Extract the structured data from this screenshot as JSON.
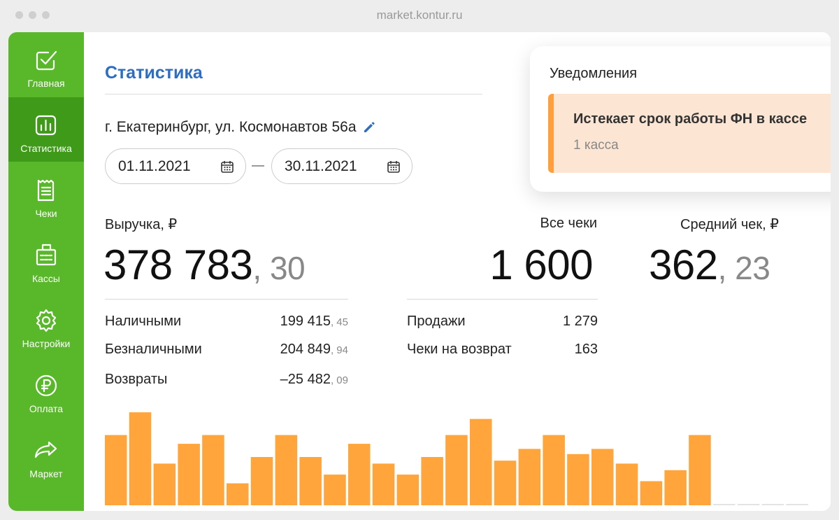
{
  "browser": {
    "url": "market.kontur.ru"
  },
  "sidebar": {
    "items": [
      {
        "label": "Главная",
        "icon": "checkbox-icon",
        "active": false
      },
      {
        "label": "Статистика",
        "icon": "chart-icon",
        "active": true
      },
      {
        "label": "Чеки",
        "icon": "receipt-icon",
        "active": false
      },
      {
        "label": "Кассы",
        "icon": "cash-register-icon",
        "active": false
      },
      {
        "label": "Настройки",
        "icon": "gear-icon",
        "active": false
      },
      {
        "label": "Оплата",
        "icon": "ruble-icon",
        "active": false
      },
      {
        "label": "Маркет",
        "icon": "share-arrow-icon",
        "active": false
      }
    ],
    "color": "#58b82a",
    "active_color": "#3f9a19"
  },
  "page": {
    "title": "Статистика",
    "address": "г. Екатеринбург, ул. Космонавтов 56а",
    "date_from": "01.11.2021",
    "date_to": "30.11.2021"
  },
  "revenue": {
    "label": "Выручка, ₽",
    "main": "378 783",
    "cents": ", 30",
    "rows": [
      {
        "label": "Наличными",
        "main": "199 415",
        "cents": ", 45"
      },
      {
        "label": "Безналичными",
        "main": "204 849",
        "cents": ", 94"
      },
      {
        "label": "Возвраты",
        "main": "–25 482",
        "cents": ", 09"
      }
    ]
  },
  "checks": {
    "label": "Все чеки",
    "value": "1 600",
    "rows": [
      {
        "label": "Продажи",
        "value": "1 279"
      },
      {
        "label": "Чеки на возврат",
        "value": "163"
      }
    ]
  },
  "average": {
    "label": "Средний чек, ₽",
    "main": "362",
    "cents": ", 23"
  },
  "notifications": {
    "title": "Уведомления",
    "items": [
      {
        "title": "Истекает срок работы ФН в кассе",
        "subtitle": "1 касса"
      }
    ]
  },
  "chart_data": {
    "type": "bar",
    "bar_color": "#ffa53c",
    "values": [
      96,
      127,
      57,
      84,
      96,
      30,
      66,
      96,
      66,
      42,
      84,
      57,
      42,
      66,
      96,
      118,
      61,
      77,
      96,
      70,
      77,
      57,
      33,
      48,
      96,
      0,
      0,
      0,
      0
    ]
  }
}
